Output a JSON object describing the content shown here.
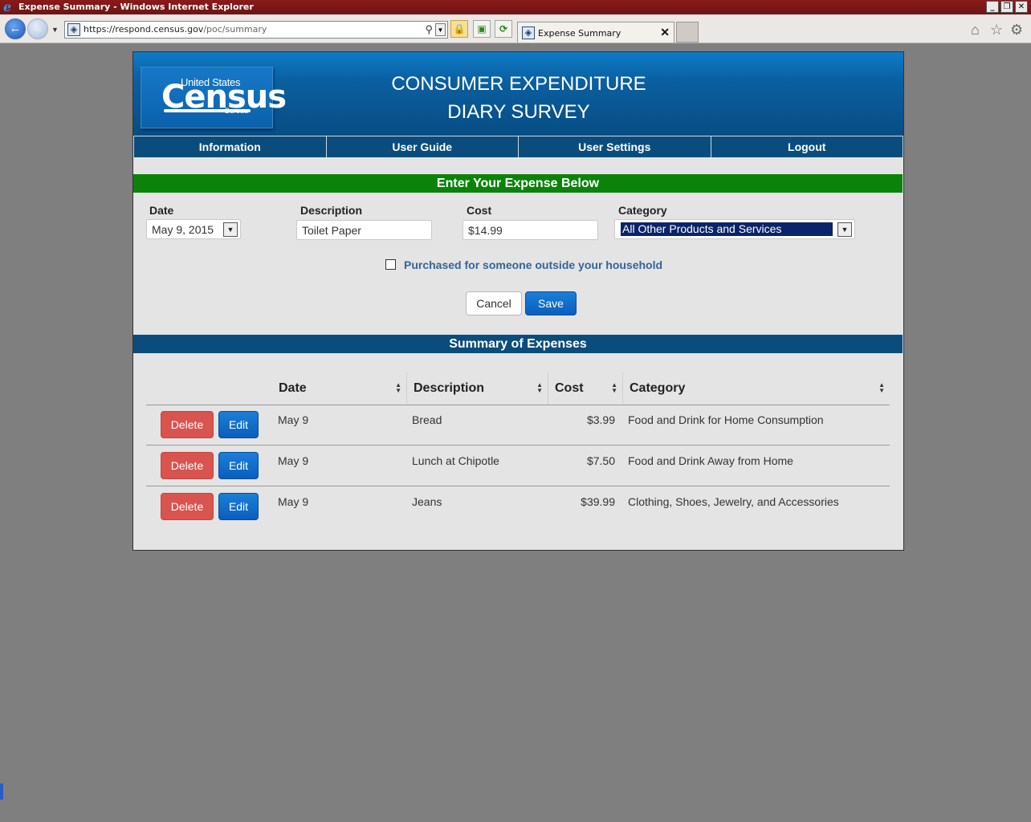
{
  "window": {
    "title": "Expense Summary - Windows Internet Explorer"
  },
  "browser": {
    "url_host": "https://respond.census.gov",
    "url_path": "/poc/summary",
    "tab_title": "Expense Summary"
  },
  "header": {
    "logo_us": "United States",
    "logo_census": "Census",
    "logo_bureau": "Bureau",
    "title_line1": "CONSUMER EXPENDITURE",
    "title_line2": "DIARY SURVEY"
  },
  "nav": {
    "items": [
      "Information",
      "User Guide",
      "User Settings",
      "Logout"
    ]
  },
  "entry": {
    "banner": "Enter Your Expense Below",
    "date_label": "Date",
    "date_value": "May 9, 2015",
    "description_label": "Description",
    "description_value": "Toilet Paper",
    "cost_label": "Cost",
    "cost_value": "$14.99",
    "category_label": "Category",
    "category_value": "All Other Products and Services",
    "outside_household_label": "Purchased for someone outside your household",
    "outside_household_checked": false,
    "cancel_label": "Cancel",
    "save_label": "Save"
  },
  "summary": {
    "banner": "Summary of Expenses",
    "columns": [
      "Date",
      "Description",
      "Cost",
      "Category"
    ],
    "delete_label": "Delete",
    "edit_label": "Edit",
    "rows": [
      {
        "date": "May 9",
        "description": "Bread",
        "cost": "$3.99",
        "category": "Food and Drink for Home Consumption"
      },
      {
        "date": "May 9",
        "description": "Lunch at Chipotle",
        "cost": "$7.50",
        "category": "Food and Drink Away from Home"
      },
      {
        "date": "May 9",
        "description": "Jeans",
        "cost": "$39.99",
        "category": "Clothing, Shoes, Jewelry, and Accessories"
      }
    ]
  },
  "colors": {
    "header_blue": "#0a5fa0",
    "nav_blue": "#0a4d7c",
    "entry_green": "#0b830b",
    "delete_red": "#d9534f",
    "primary_blue": "#0a5ebd"
  }
}
